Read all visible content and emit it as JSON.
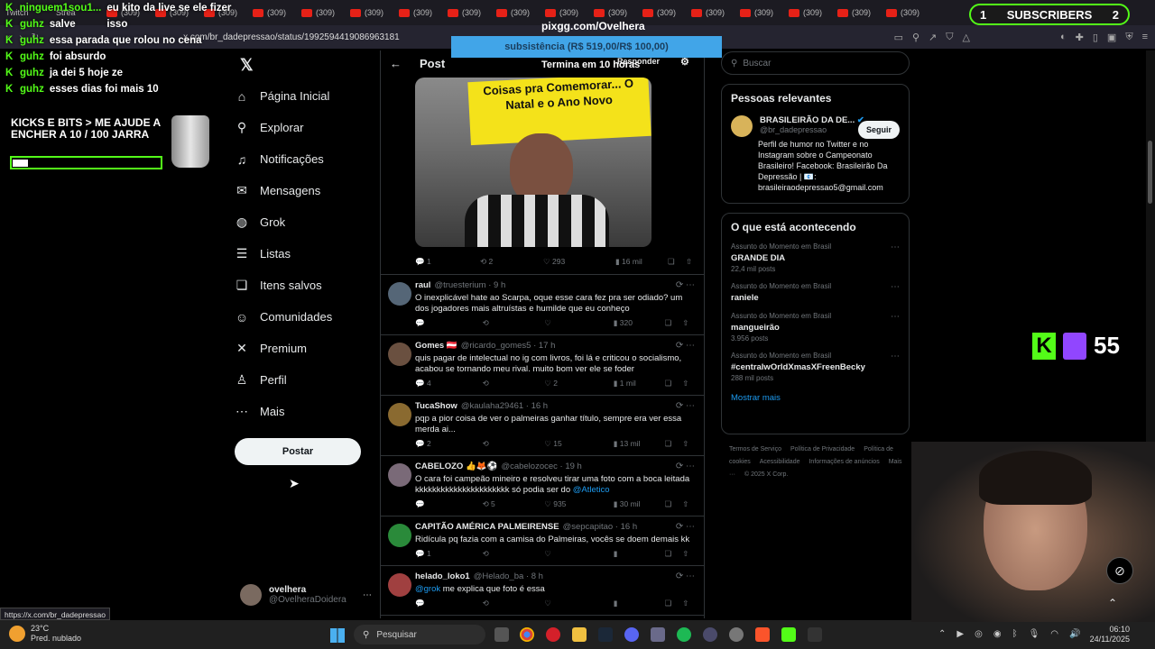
{
  "browser": {
    "tabs": [
      "Twitch",
      "Strea",
      "(309)",
      "(309)",
      "(309)",
      "(309)",
      "(309)",
      "(309)",
      "(309)",
      "(309)",
      "(309)",
      "(309)",
      "(309)",
      "(309)",
      "(309)",
      "(309)",
      "(309)",
      "(309)",
      "(309)"
    ],
    "url": "x.com/br_dadepressao/status/1992594419086963181",
    "status_url": "https://x.com/br_dadepressao"
  },
  "stream": {
    "chat": [
      {
        "user": "ninguem1sou1...",
        "msg": "eu kito da live se ele fizer isso"
      },
      {
        "user": "guhz",
        "msg": "salve"
      },
      {
        "user": "guhz",
        "msg": "essa parada que rolou no cena"
      },
      {
        "user": "guhz",
        "msg": "foi absurdo"
      },
      {
        "user": "guhz",
        "msg": "ja dei 5 hoje ze"
      },
      {
        "user": "guhz",
        "msg": "esses dias foi mais 10"
      }
    ],
    "goal_text": "KICKS E BITS > ME AJUDE A ENCHER A  10   / 100 JARRA",
    "goal_progress": 0.1,
    "pixgg_title": "pixgg.com/Ovelhera",
    "subsistencia": "subsistência (R$ 519,00/R$ 100,00)",
    "termina": "Termina em 10 horas",
    "subs_left": "1",
    "subs_label": "SUBSCRIBERS",
    "subs_right": "2",
    "kick_letter": "K",
    "viewer_count": "55"
  },
  "x": {
    "nav": [
      {
        "label": "Página Inicial",
        "icon": "home-icon",
        "glyph": "⌂"
      },
      {
        "label": "Explorar",
        "icon": "search-icon",
        "glyph": "⚲"
      },
      {
        "label": "Notificações",
        "icon": "bell-icon",
        "glyph": "♫"
      },
      {
        "label": "Mensagens",
        "icon": "mail-icon",
        "glyph": "✉"
      },
      {
        "label": "Grok",
        "icon": "grok-icon",
        "glyph": "◍"
      },
      {
        "label": "Listas",
        "icon": "list-icon",
        "glyph": "☰"
      },
      {
        "label": "Itens salvos",
        "icon": "bookmark-icon",
        "glyph": "❏"
      },
      {
        "label": "Comunidades",
        "icon": "communities-icon",
        "glyph": "☺"
      },
      {
        "label": "Premium",
        "icon": "x-premium-icon",
        "glyph": "✕"
      },
      {
        "label": "Perfil",
        "icon": "profile-icon",
        "glyph": "♙"
      },
      {
        "label": "Mais",
        "icon": "more-icon",
        "glyph": "⋯"
      }
    ],
    "post_button": "Postar",
    "profile_name": "ovelhera",
    "profile_handle": "@OvelheraDoidera",
    "header_title": "Post",
    "responder": "Responder",
    "sign_text": "Coisas pra Comemorar... O Natal e o Ano Novo",
    "main_post_actions": {
      "replies": "1",
      "reposts": "2",
      "likes": "293",
      "views": "16 mil"
    },
    "replies": [
      {
        "name": "raul",
        "handle": "@truesterium · 9 h",
        "text": "O inexplicável hate ao Scarpa, oque esse cara fez pra ser odiado? um dos jogadores mais altruístas e humilde que eu conheço",
        "replies": "",
        "reposts": "",
        "likes": "",
        "views": "320",
        "avatar": "#556677"
      },
      {
        "name": "Gomes 🇦🇹",
        "handle": "@ricardo_gomes5 · 17 h",
        "text": "quis pagar de intelectual no ig com livros, foi lá e criticou o socialismo, acabou se tornando meu rival. muito bom ver ele se foder",
        "replies": "4",
        "reposts": "",
        "likes": "2",
        "views": "1 mil",
        "avatar": "#6a5040"
      },
      {
        "name": "TucaShow",
        "handle": "@kaulaha29461 · 16 h",
        "text": "pqp a pior coisa de ver o palmeiras ganhar título, sempre era ver essa merda ai...",
        "replies": "2",
        "reposts": "",
        "likes": "15",
        "views": "13 mil",
        "avatar": "#8a6a30"
      },
      {
        "name": "CABELOZO 👍🦊⚽",
        "handle": "@cabelozocec · 19 h",
        "text": "O cara foi campeão mineiro e resolveu tirar uma foto com a boca leitada kkkkkkkkkkkkkkkkkkkkkk só podia ser do ",
        "mention": "@Atletico",
        "replies": "",
        "reposts": "5",
        "likes": "935",
        "views": "30 mil",
        "avatar": "#7a6a78"
      },
      {
        "name": "CAPITÃO AMÉRICA PALMEIRENSE",
        "handle": "@sepcapitao · 16 h",
        "text": "Ridícula pq fazia com a camisa do Palmeiras, vocês se doem demais kk",
        "replies": "1",
        "reposts": "",
        "likes": "",
        "views": "",
        "avatar": "#2a8a3a"
      },
      {
        "name": "helado_loko1",
        "handle": "@Helado_ba · 8 h",
        "text": " me explica que foto é essa",
        "mention_first": "@grok",
        "replies": "",
        "reposts": "",
        "likes": "",
        "views": "",
        "avatar": "#a04040"
      }
    ],
    "search_placeholder": "Buscar",
    "relevant_title": "Pessoas relevantes",
    "relevant_name": "BRASILEIRÃO DA DE...",
    "relevant_handle": "@br_dadepressao",
    "follow": "Seguir",
    "relevant_bio": "Perfil de humor no Twitter e no Instagram sobre o Campeonato Brasileiro! Facebook: Brasileirão Da Depressão | 📧: brasileiraodepressao5@gmail.com",
    "trends_title": "O que está acontecendo",
    "trends": [
      {
        "context": "Assunto do Momento em Brasil",
        "name": "GRANDE DIA",
        "count": "22,4 mil posts"
      },
      {
        "context": "Assunto do Momento em Brasil",
        "name": "raniele",
        "count": ""
      },
      {
        "context": "Assunto do Momento em Brasil",
        "name": "mangueirão",
        "count": "3.956 posts"
      },
      {
        "context": "Assunto do Momento em Brasil",
        "name": "#centralwOrldXmasXFreenBecky",
        "count": "288 mil posts"
      }
    ],
    "show_more": "Mostrar mais",
    "footer": [
      "Termos de Serviço",
      "Política de Privacidade",
      "Política de cookies",
      "Acessibilidade",
      "Informações de anúncios",
      "Mais ···",
      "© 2025 X Corp."
    ]
  },
  "taskbar": {
    "temp": "23°C",
    "weather": "Pred. nublado",
    "search": "Pesquisar",
    "time": "06:10",
    "date": "24/11/2025"
  }
}
